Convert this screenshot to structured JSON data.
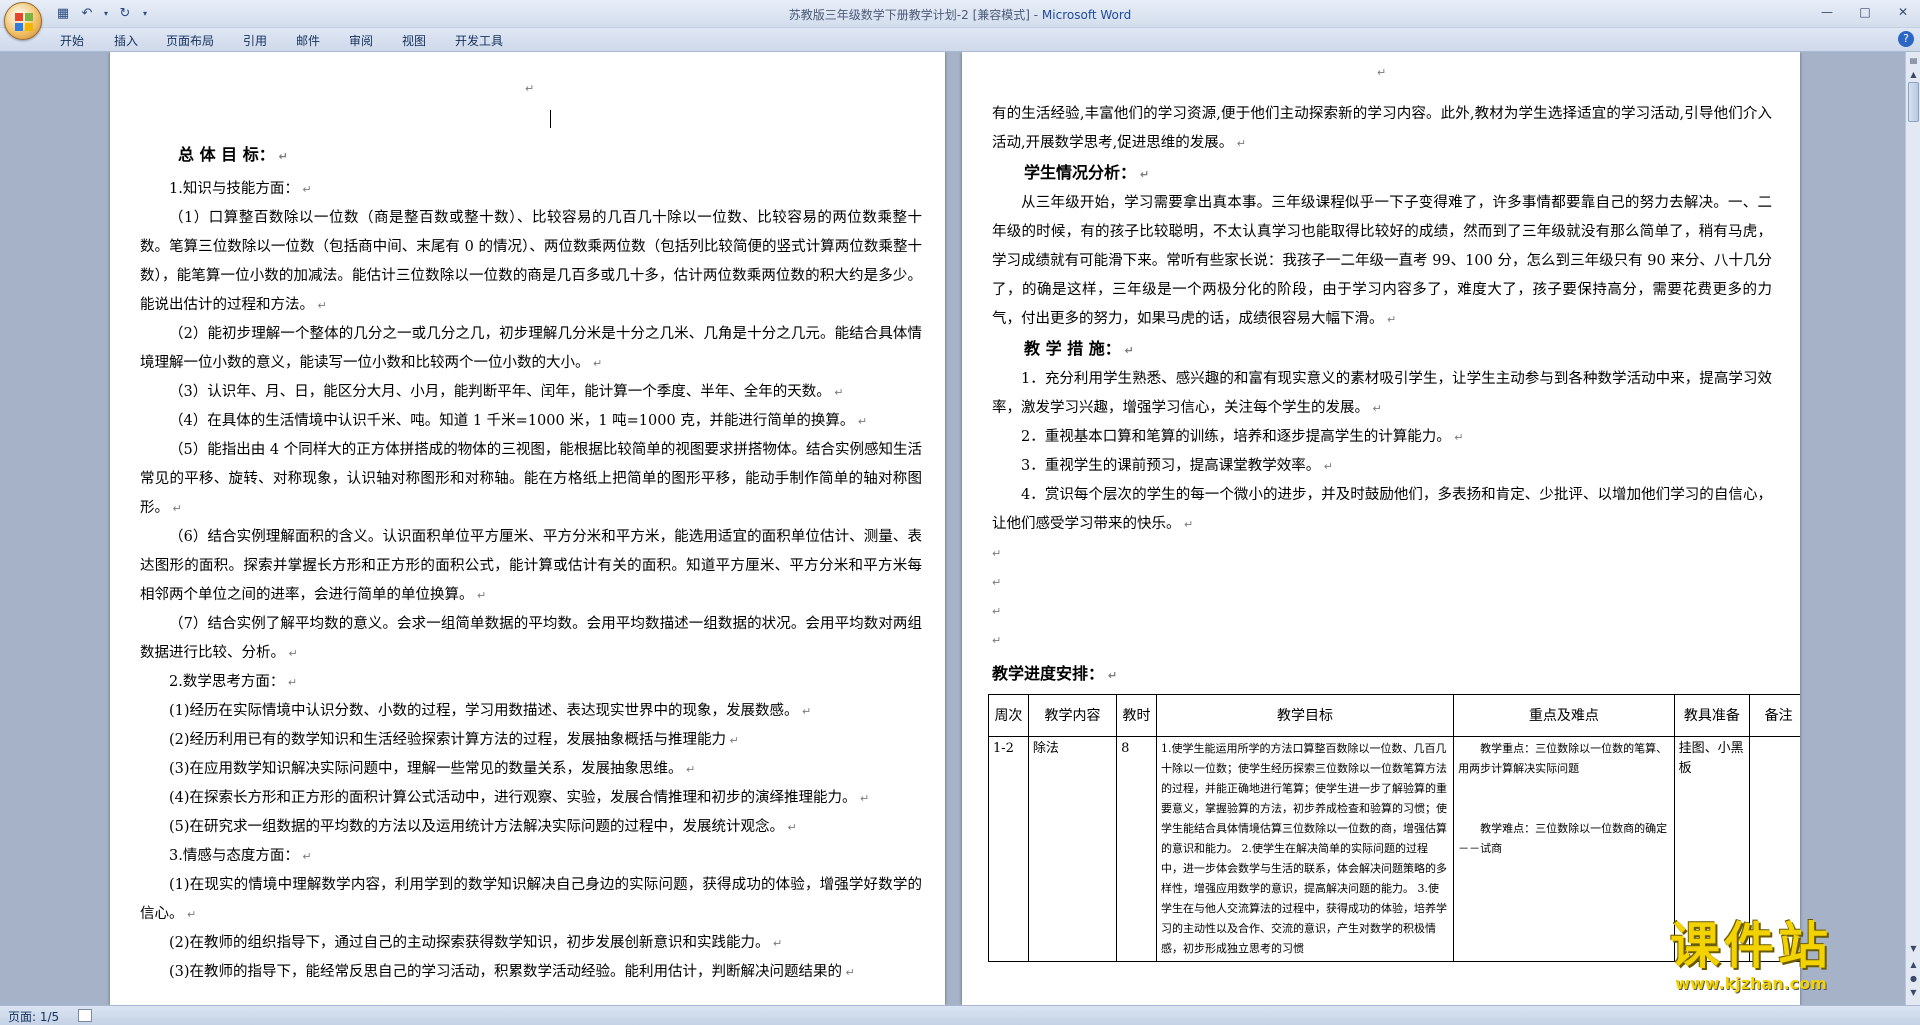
{
  "window": {
    "title": "苏教版三年级数学下册教学计划-2 [兼容模式]",
    "title_sep": " - ",
    "app": "Microsoft Word"
  },
  "ribbon_tabs": [
    "开始",
    "插入",
    "页面布局",
    "引用",
    "邮件",
    "审阅",
    "视图",
    "开发工具"
  ],
  "page1": {
    "heading": "总 体 目 标：",
    "paragraphs": [
      {
        "style": "ind",
        "text": "1.知识与技能方面："
      },
      {
        "style": "ind",
        "text": "（1）口算整百数除以一位数（商是整百数或整十数）、比较容易的几百几十除以一位数、比较容易的两位数乘整十数。笔算三位数除以一位数（包括商中间、末尾有 0 的情况）、两位数乘两位数（包括列比较简便的竖式计算两位数乘整十数），能笔算一位小数的加减法。能估计三位数除以一位数的商是几百多或几十多，估计两位数乘两位数的积大约是多少。能说出估计的过程和方法。"
      },
      {
        "style": "ind",
        "text": "（2）能初步理解一个整体的几分之一或几分之几，初步理解几分米是十分之几米、几角是十分之几元。能结合具体情境理解一位小数的意义，能读写一位小数和比较两个一位小数的大小。"
      },
      {
        "style": "ind",
        "text": "（3）认识年、月、日，能区分大月、小月，能判断平年、闰年，能计算一个季度、半年、全年的天数。"
      },
      {
        "style": "ind",
        "text": "（4）在具体的生活情境中认识千米、吨。知道 1 千米=1000 米，1 吨=1000 克，并能进行简单的换算。"
      },
      {
        "style": "ind",
        "text": "（5）能指出由 4 个同样大的正方体拼搭成的物体的三视图，能根据比较简单的视图要求拼搭物体。结合实例感知生活常见的平移、旋转、对称现象，认识轴对称图形和对称轴。能在方格纸上把简单的图形平移，能动手制作简单的轴对称图形。"
      },
      {
        "style": "ind",
        "text": "（6）结合实例理解面积的含义。认识面积单位平方厘米、平方分米和平方米，能选用适宜的面积单位估计、测量、表达图形的面积。探索并掌握长方形和正方形的面积公式，能计算或估计有关的面积。知道平方厘米、平方分米和平方米每相邻两个单位之间的进率，会进行简单的单位换算。"
      },
      {
        "style": "ind",
        "text": "（7）结合实例了解平均数的意义。会求一组简单数据的平均数。会用平均数描述一组数据的状况。会用平均数对两组数据进行比较、分析。"
      },
      {
        "style": "ind",
        "text": "2.数学思考方面："
      },
      {
        "style": "ind",
        "text": "(1)经历在实际情境中认识分数、小数的过程，学习用数描述、表达现实世界中的现象，发展数感。"
      },
      {
        "style": "ind",
        "text": "(2)经历利用已有的数学知识和生活经验探索计算方法的过程，发展抽象概括与推理能力"
      },
      {
        "style": "ind",
        "text": "(3)在应用数学知识解决实际问题中，理解一些常见的数量关系，发展抽象思维。"
      },
      {
        "style": "ind",
        "text": "(4)在探索长方形和正方形的面积计算公式活动中，进行观察、实验，发展合情推理和初步的演绎推理能力。"
      },
      {
        "style": "ind",
        "text": "(5)在研究求一组数据的平均数的方法以及运用统计方法解决实际问题的过程中，发展统计观念。"
      },
      {
        "style": "ind",
        "text": "3.情感与态度方面："
      },
      {
        "style": "ind",
        "text": "(1)在现实的情境中理解数学内容，利用学到的数学知识解决自己身边的实际问题，获得成功的体验，增强学好数学的信心。"
      },
      {
        "style": "ind",
        "text": "(2)在教师的组织指导下，通过自己的主动探索获得数学知识，初步发展创新意识和实践能力。"
      },
      {
        "style": "ind",
        "text": "(3)在教师的指导下，能经常反思自己的学习活动，积累数学活动经验。能利用估计，判断解决问题结果的"
      }
    ]
  },
  "page2": {
    "paragraphs": [
      {
        "style": "",
        "text": "有的生活经验,丰富他们的学习资源,便于他们主动探索新的学习内容。此外,教材为学生选择适宜的学习活动,引导他们介入活动,开展数学思考,促进思维的发展。"
      },
      {
        "style": "ind head",
        "text": "学生情况分析："
      },
      {
        "style": "ind",
        "text": "从三年级开始，学习需要拿出真本事。三年级课程似乎一下子变得难了，许多事情都要靠自己的努力去解决。一、二年级的时候，有的孩子比较聪明，不太认真学习也能取得比较好的成绩，然而到了三年级就没有那么简单了，稍有马虎，学习成绩就有可能滑下来。常听有些家长说：我孩子一二年级一直考 99、100 分，怎么到三年级只有 90 来分、八十几分了，的确是这样，三年级是一个两极分化的阶段，由于学习内容多了，难度大了，孩子要保持高分，需要花费更多的力气，付出更多的努力，如果马虎的话，成绩很容易大幅下滑。"
      },
      {
        "style": "ind head",
        "text": "教 学 措 施："
      },
      {
        "style": "ind",
        "text": "1．充分利用学生熟悉、感兴趣的和富有现实意义的素材吸引学生，让学生主动参与到各种数学活动中来，提高学习效率，激发学习兴趣，增强学习信心，关注每个学生的发展。"
      },
      {
        "style": "ind",
        "text": "2．重视基本口算和笔算的训练，培养和逐步提高学生的计算能力。"
      },
      {
        "style": "ind",
        "text": "3．重视学生的课前预习，提高课堂教学效率。"
      },
      {
        "style": "ind",
        "text": "4．赏识每个层次的学生的每一个微小的进步，并及时鼓励他们，多表扬和肯定、少批评、以增加他们学习的自信心，让他们感受学习带来的快乐。"
      },
      {
        "style": "",
        "text": ""
      },
      {
        "style": "",
        "text": ""
      },
      {
        "style": "",
        "text": ""
      },
      {
        "style": "",
        "text": ""
      }
    ],
    "schedule_title": "教学进度安排：",
    "table": {
      "headers": [
        "周次",
        "教学内容",
        "教时",
        "教学目标",
        "重点及难点",
        "教具准备",
        "备注"
      ],
      "rows": [
        {
          "week": "1-2",
          "content": "除法",
          "hours": "8",
          "goals": "1.使学生能运用所学的方法口算整百数除以一位数、几百几十除以一位数；使学生经历探索三位数除以一位数笔算方法的过程，并能正确地进行笔算；使学生进一步了解验算的重要意义，掌握验算的方法，初步养成检查和验算的习惯；使学生能结合具体情境估算三位数除以一位数的商，增强估算的意识和能力。 2.使学生在解决简单的实际问题的过程中，进一步体会数学与生活的联系，体会解决问题策略的多样性，增强应用数学的意识，提高解决问题的能力。 3.使学生在与他人交流算法的过程中，获得成功的体验，培养学习的主动性以及合作、交流的意识，产生对数学的积极情感，初步形成独立思考的习惯",
          "key_points": "教学重点：三位数除以一位数的笔算、用两步计算解决实际问题",
          "difficulties": "教学难点：三位数除以一位数商的确定－－试商",
          "aids": "挂图、小黑板",
          "notes": ""
        }
      ]
    }
  },
  "statusbar": {
    "page_indicator": "页面: 1/5"
  },
  "watermark": {
    "brand": "课件站",
    "url": "www.kjzhan.com"
  },
  "colors": {
    "titlebar": "#dbe4f2",
    "doc_background": "#a5b2c7",
    "watermark": "#f2d200"
  }
}
